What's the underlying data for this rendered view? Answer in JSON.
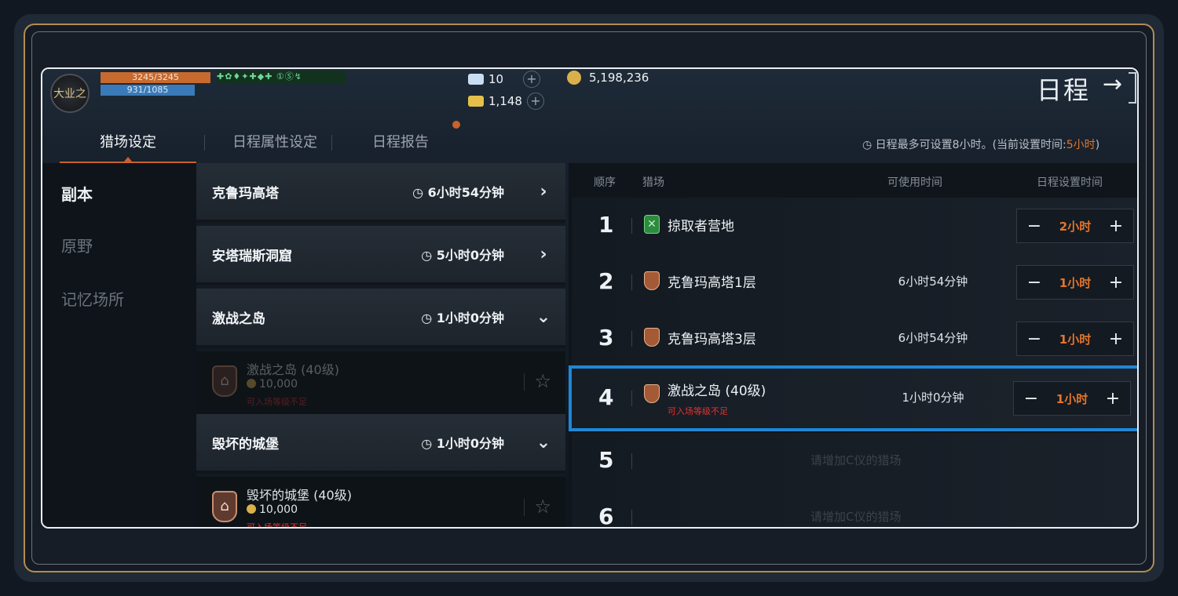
{
  "player": {
    "avatar_text": "大业之",
    "hp": "3245/3245",
    "mp": "931/1085",
    "buffs": "✚✿♦✦✚◆✚ ①Ⓢ↯"
  },
  "currency": {
    "diamond": "10",
    "gold_gem": "1,148",
    "gold": "5,198,236"
  },
  "header": {
    "title": "日程",
    "exit_icon": "arrow-right"
  },
  "tabs": [
    {
      "label": "猎场设定",
      "active": true
    },
    {
      "label": "日程属性设定"
    },
    {
      "label": "日程报告"
    }
  ],
  "notice": {
    "text": "日程最多可设置8小时。(当前设置时间:",
    "value": "5小时",
    "end": ")"
  },
  "sidebar": {
    "items": [
      {
        "label": "副本",
        "active": true
      },
      {
        "label": "原野"
      },
      {
        "label": "记忆场所"
      }
    ]
  },
  "categories": [
    {
      "name": "克鲁玛高塔",
      "time": "6小时54分钟",
      "chevron": "›"
    },
    {
      "name": "安塔瑞斯洞窟",
      "time": "5小时0分钟",
      "chevron": "›"
    },
    {
      "name": "激战之岛",
      "time": "1小时0分钟",
      "chevron": "⌄"
    },
    {
      "name": "毁坏的城堡",
      "time": "1小时0分钟",
      "chevron": "⌄"
    }
  ],
  "sub_items": [
    {
      "name": "激战之岛 (40级)",
      "cost": "10,000",
      "warn": "可入场等级不足"
    },
    {
      "name": "毁坏的城堡 (40级)",
      "cost": "10,000",
      "warn": "可入场等级不足"
    }
  ],
  "table": {
    "headers": {
      "order": "顺序",
      "hunt": "猎场",
      "avail": "可使用时间",
      "set": "日程设置时间"
    },
    "rows": [
      {
        "num": "1",
        "name": "掠取者营地",
        "avail": "",
        "val": "2小时"
      },
      {
        "num": "2",
        "name": "克鲁玛高塔1层",
        "avail": "6小时54分钟",
        "val": "1小时"
      },
      {
        "num": "3",
        "name": "克鲁玛高塔3层",
        "avail": "6小时54分钟",
        "val": "1小时"
      },
      {
        "num": "4",
        "name": "激战之岛 (40级)",
        "avail": "1小时0分钟",
        "val": "1小时",
        "warn": "可入场等级不足"
      },
      {
        "num": "5",
        "empty": "请增加C仪的猎场"
      },
      {
        "num": "6",
        "empty": "请增加C仪的猎场"
      }
    ]
  },
  "colors": {
    "accent": "#e3752d",
    "select": "#1f87d6",
    "warn": "#e3312e"
  }
}
